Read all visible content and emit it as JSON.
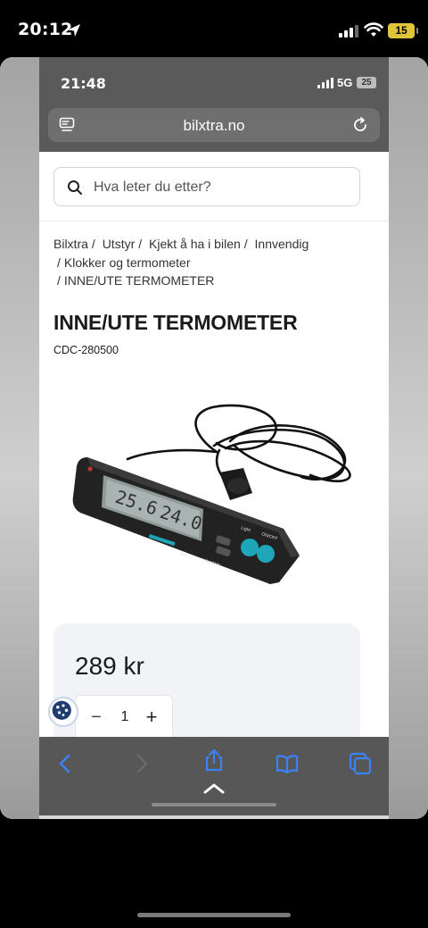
{
  "outer_status": {
    "time": "20:12",
    "battery": "15",
    "colors": {
      "battery": "#e0c53a"
    }
  },
  "inner_status": {
    "time": "21:48",
    "network": "5G",
    "battery": "25"
  },
  "browser": {
    "url": "bilxtra.no",
    "toolbar_icons": [
      "back-icon",
      "forward-icon",
      "share-icon",
      "bookmarks-icon",
      "tabs-icon",
      "chevron-up-icon"
    ]
  },
  "search": {
    "placeholder": "Hva leter du etter?"
  },
  "breadcrumbs": [
    {
      "label": "Bilxtra"
    },
    {
      "label": "Utstyr"
    },
    {
      "label": "Kjekt å ha i bilen"
    },
    {
      "label": "Innvendig"
    },
    {
      "label": "Klokker og termometer"
    },
    {
      "label": "INNE/UTE TERMOMETER"
    }
  ],
  "breadcrumb_separator": "/",
  "product": {
    "title": "INNE/UTE TERMOMETER",
    "sku": "CDC-280500",
    "display_values": [
      "25.6",
      "24.0"
    ],
    "button_labels": [
      "Light",
      "ON/OFF",
      "Ice",
      "MAX/MIN"
    ],
    "price": "289 kr",
    "quantity": "1",
    "quantity_minus": "−",
    "quantity_plus": "+"
  },
  "colors": {
    "page_bg": "#ffffff",
    "browser_chrome": "#5a5a5a",
    "price_card_bg": "#f1f3f7",
    "accent_button": "#1fa5b8",
    "ios_blue": "#3b82f6"
  }
}
